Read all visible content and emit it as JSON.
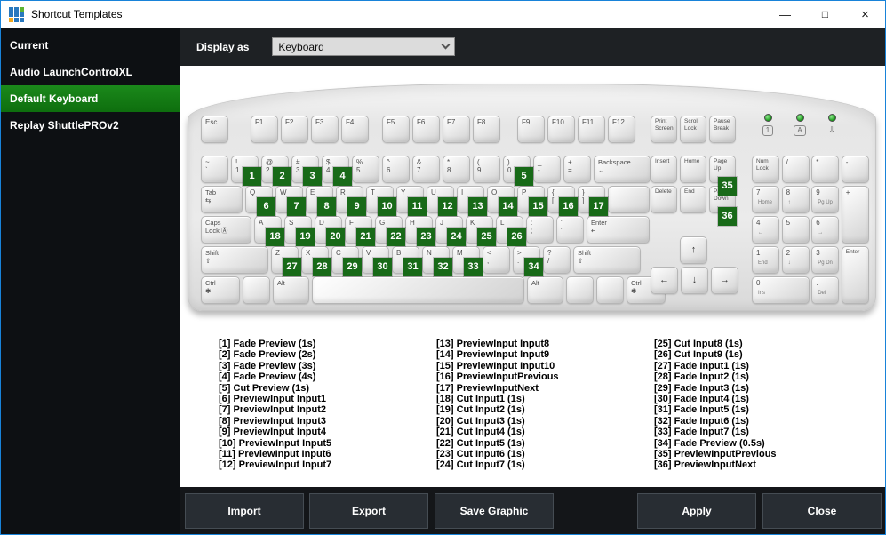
{
  "window": {
    "title": "Shortcut Templates",
    "controls": {
      "minimize": "—",
      "maximize": "□",
      "close": "×"
    }
  },
  "colors": {
    "accent_blue": "#1883d9",
    "selected_green": "#137a13",
    "badge_green": "#186a18",
    "led_green": "#22a022",
    "sidebar_bg": "#0d1013",
    "toolbar_bg": "#1e2124",
    "footer_bg": "#141619",
    "button_bg": "#282d33",
    "logo_blue": "#2878be",
    "logo_green": "#5cb332",
    "logo_orange": "#f2a71b"
  },
  "sidebar": {
    "items": [
      {
        "label": "Current",
        "selected": false
      },
      {
        "label": "Audio LaunchControlXL",
        "selected": false
      },
      {
        "label": "Default Keyboard",
        "selected": true
      },
      {
        "label": "Replay ShuttlePROv2",
        "selected": false
      }
    ]
  },
  "toolbar": {
    "label": "Display as",
    "value": "Keyboard"
  },
  "keyboard": {
    "esc": {
      "lines": [
        "Esc"
      ]
    },
    "function_groups": [
      [
        {
          "lines": [
            "F1"
          ]
        },
        {
          "lines": [
            "F2"
          ]
        },
        {
          "lines": [
            "F3"
          ]
        },
        {
          "lines": [
            "F4"
          ]
        }
      ],
      [
        {
          "lines": [
            "F5"
          ]
        },
        {
          "lines": [
            "F6"
          ]
        },
        {
          "lines": [
            "F7"
          ]
        },
        {
          "lines": [
            "F8"
          ]
        }
      ],
      [
        {
          "lines": [
            "F9"
          ]
        },
        {
          "lines": [
            "F10"
          ]
        },
        {
          "lines": [
            "F11"
          ]
        },
        {
          "lines": [
            "F12"
          ]
        }
      ]
    ],
    "system_keys": [
      {
        "lines": [
          "Print",
          "Screen"
        ],
        "cls": "sys"
      },
      {
        "lines": [
          "Scroll",
          "Lock"
        ],
        "cls": "sys"
      },
      {
        "lines": [
          "Pause",
          "Break"
        ],
        "cls": "sys"
      }
    ],
    "leds": [
      {
        "symbol": "1",
        "boxed": true
      },
      {
        "symbol": "A",
        "boxed": true
      },
      {
        "symbol": "⇩",
        "boxed": false
      }
    ],
    "main_rows": [
      {
        "keys": [
          {
            "lines": [
              "~",
              "`"
            ]
          },
          {
            "lines": [
              "!",
              "1"
            ],
            "badge": "1"
          },
          {
            "lines": [
              "@",
              "2"
            ],
            "badge": "2"
          },
          {
            "lines": [
              "#",
              "3"
            ],
            "badge": "3"
          },
          {
            "lines": [
              "$",
              "4"
            ],
            "badge": "4"
          },
          {
            "lines": [
              "%",
              "5"
            ]
          },
          {
            "lines": [
              "^",
              "6"
            ]
          },
          {
            "lines": [
              "&",
              "7"
            ]
          },
          {
            "lines": [
              "*",
              "8"
            ]
          },
          {
            "lines": [
              "(",
              "9"
            ]
          },
          {
            "lines": [
              ")",
              "0"
            ],
            "badge": "5"
          },
          {
            "lines": [
              "_",
              "-"
            ]
          },
          {
            "lines": [
              "+",
              "="
            ]
          },
          {
            "lines": [
              "Backspace",
              "←"
            ],
            "w": 2,
            "cls": "mod"
          }
        ]
      },
      {
        "keys": [
          {
            "lines": [
              "Tab",
              "⇆"
            ],
            "w": 1.5,
            "cls": "mod"
          },
          {
            "lines": [
              "Q"
            ],
            "badge": "6"
          },
          {
            "lines": [
              "W"
            ],
            "badge": "7"
          },
          {
            "lines": [
              "E"
            ],
            "badge": "8"
          },
          {
            "lines": [
              "R"
            ],
            "badge": "9"
          },
          {
            "lines": [
              "T"
            ],
            "badge": "10"
          },
          {
            "lines": [
              "Y"
            ],
            "badge": "11"
          },
          {
            "lines": [
              "U"
            ],
            "badge": "12"
          },
          {
            "lines": [
              "I"
            ],
            "badge": "13"
          },
          {
            "lines": [
              "O"
            ],
            "badge": "14"
          },
          {
            "lines": [
              "P"
            ],
            "badge": "15"
          },
          {
            "lines": [
              "{",
              "["
            ],
            "badge": "16"
          },
          {
            "lines": [
              "}",
              "]"
            ],
            "badge": "17"
          },
          {
            "lines": [
              ""
            ],
            "w": 1.5
          }
        ]
      },
      {
        "keys": [
          {
            "lines": [
              "Caps",
              "Lock Ⓐ"
            ],
            "w": 1.8,
            "cls": "mod"
          },
          {
            "lines": [
              "A"
            ],
            "badge": "18"
          },
          {
            "lines": [
              "S"
            ],
            "badge": "19"
          },
          {
            "lines": [
              "D"
            ],
            "badge": "20"
          },
          {
            "lines": [
              "F"
            ],
            "badge": "21"
          },
          {
            "lines": [
              "G"
            ],
            "badge": "22"
          },
          {
            "lines": [
              "H"
            ],
            "badge": "23"
          },
          {
            "lines": [
              "J"
            ],
            "badge": "24"
          },
          {
            "lines": [
              "K"
            ],
            "badge": "25"
          },
          {
            "lines": [
              "L"
            ],
            "badge": "26"
          },
          {
            "lines": [
              ":",
              ";"
            ]
          },
          {
            "lines": [
              "\"",
              "'"
            ]
          },
          {
            "lines": [
              "Enter",
              "↵"
            ],
            "w": 2.2,
            "cls": "mod"
          }
        ]
      },
      {
        "keys": [
          {
            "lines": [
              "Shift",
              "⇧"
            ],
            "w": 2.35,
            "cls": "mod"
          },
          {
            "lines": [
              "Z"
            ],
            "badge": "27"
          },
          {
            "lines": [
              "X"
            ],
            "badge": "28"
          },
          {
            "lines": [
              "C"
            ],
            "badge": "29"
          },
          {
            "lines": [
              "V"
            ],
            "badge": "30"
          },
          {
            "lines": [
              "B"
            ],
            "badge": "31"
          },
          {
            "lines": [
              "N"
            ],
            "badge": "32"
          },
          {
            "lines": [
              "M"
            ],
            "badge": "33"
          },
          {
            "lines": [
              "<",
              ","
            ]
          },
          {
            "lines": [
              ">",
              "."
            ],
            "badge": "34"
          },
          {
            "lines": [
              "?",
              "/"
            ]
          },
          {
            "lines": [
              "Shift",
              "⇧"
            ],
            "w": 2.35,
            "cls": "mod"
          }
        ]
      },
      {
        "keys": [
          {
            "lines": [
              "Ctrl",
              "✱"
            ],
            "w": 1.4,
            "cls": "mod"
          },
          {
            "lines": [
              ""
            ],
            "w": 1.0
          },
          {
            "lines": [
              "Alt"
            ],
            "w": 1.3,
            "cls": "mod"
          },
          {
            "lines": [
              ""
            ],
            "w": 7.2
          },
          {
            "lines": [
              "Alt"
            ],
            "w": 1.3,
            "cls": "mod"
          },
          {
            "lines": [
              ""
            ],
            "w": 1.0
          },
          {
            "lines": [
              ""
            ],
            "w": 1.0
          },
          {
            "lines": [
              "Ctrl",
              "✱"
            ],
            "w": 1.4,
            "cls": "mod"
          }
        ]
      }
    ],
    "nav_rows": [
      [
        {
          "lines": [
            "Insert"
          ],
          "cls": "sys"
        },
        {
          "lines": [
            "Home"
          ],
          "cls": "sys"
        },
        {
          "lines": [
            "Page",
            "Up"
          ],
          "cls": "sys",
          "badge": "35",
          "hang": true
        }
      ],
      [
        {
          "lines": [
            "Delete"
          ],
          "cls": "sys"
        },
        {
          "lines": [
            "End"
          ],
          "cls": "sys"
        },
        {
          "lines": [
            "Page",
            "Down"
          ],
          "cls": "sys",
          "badge": "36",
          "hang": true
        }
      ]
    ],
    "arrows": {
      "up": "↑",
      "left": "←",
      "down": "↓",
      "right": "→"
    },
    "numpad": {
      "cells": [
        {
          "col": 0,
          "row": 0,
          "lines": [
            "Num",
            "Lock"
          ],
          "cls": "sys"
        },
        {
          "col": 1,
          "row": 0,
          "lines": [
            "/"
          ],
          "cls": "np"
        },
        {
          "col": 2,
          "row": 0,
          "lines": [
            "*"
          ],
          "cls": "np"
        },
        {
          "col": 3,
          "row": 0,
          "lines": [
            "-"
          ],
          "cls": "np"
        },
        {
          "col": 0,
          "row": 1,
          "lines": [
            "7",
            "Home"
          ],
          "cls": "np"
        },
        {
          "col": 1,
          "row": 1,
          "lines": [
            "8",
            "↑"
          ],
          "cls": "np"
        },
        {
          "col": 2,
          "row": 1,
          "lines": [
            "9",
            "Pg Up"
          ],
          "cls": "np"
        },
        {
          "col": 3,
          "row": 1,
          "rows": 2,
          "lines": [
            "+"
          ],
          "cls": "np"
        },
        {
          "col": 0,
          "row": 2,
          "lines": [
            "4",
            "←"
          ],
          "cls": "np"
        },
        {
          "col": 1,
          "row": 2,
          "lines": [
            "5"
          ],
          "cls": "np"
        },
        {
          "col": 2,
          "row": 2,
          "lines": [
            "6",
            "→"
          ],
          "cls": "np"
        },
        {
          "col": 0,
          "row": 3,
          "lines": [
            "1",
            "End"
          ],
          "cls": "np"
        },
        {
          "col": 1,
          "row": 3,
          "lines": [
            "2",
            "↓"
          ],
          "cls": "np"
        },
        {
          "col": 2,
          "row": 3,
          "rows": 2,
          "lines": [
            "3",
            "Pg Dn"
          ],
          "cls": "np",
          "h1": true
        },
        {
          "col": 3,
          "row": 3,
          "rows": 2,
          "lines": [
            "Enter"
          ],
          "cls": "sys"
        },
        {
          "col": 0,
          "row": 4,
          "cols": 2,
          "lines": [
            "0",
            "Ins"
          ],
          "cls": "np"
        },
        {
          "col": 2,
          "row": 4,
          "lines": [
            ".",
            "Del"
          ],
          "cls": "np"
        }
      ]
    }
  },
  "shortcuts": {
    "columns": [
      [
        "[1] Fade Preview (1s)",
        "[2] Fade Preview (2s)",
        "[3] Fade Preview (3s)",
        "[4] Fade Preview (4s)",
        "[5] Cut Preview (1s)",
        "[6] PreviewInput Input1",
        "[7] PreviewInput Input2",
        "[8] PreviewInput Input3",
        "[9] PreviewInput Input4",
        "[10] PreviewInput Input5",
        "[11] PreviewInput Input6",
        "[12] PreviewInput Input7"
      ],
      [
        "[13] PreviewInput Input8",
        "[14] PreviewInput Input9",
        "[15] PreviewInput Input10",
        "[16] PreviewInputPrevious",
        "[17] PreviewInputNext",
        "[18] Cut Input1 (1s)",
        "[19] Cut Input2 (1s)",
        "[20] Cut Input3 (1s)",
        "[21] Cut Input4 (1s)",
        "[22] Cut Input5 (1s)",
        "[23] Cut Input6 (1s)",
        "[24] Cut Input7 (1s)"
      ],
      [
        "[25] Cut Input8 (1s)",
        "[26] Cut Input9 (1s)",
        "[27] Fade Input1 (1s)",
        "[28] Fade Input2 (1s)",
        "[29] Fade Input3 (1s)",
        "[30] Fade Input4 (1s)",
        "[31] Fade Input5 (1s)",
        "[32] Fade Input6 (1s)",
        "[33] Fade Input7 (1s)",
        "[34] Fade Preview (0.5s)",
        "[35] PreviewInputPrevious",
        "[36] PreviewInputNext"
      ]
    ]
  },
  "footer": {
    "buttons": [
      {
        "label": "Import"
      },
      {
        "label": "Export"
      },
      {
        "label": "Save Graphic"
      },
      {
        "label": "Apply"
      },
      {
        "label": "Close"
      }
    ]
  }
}
